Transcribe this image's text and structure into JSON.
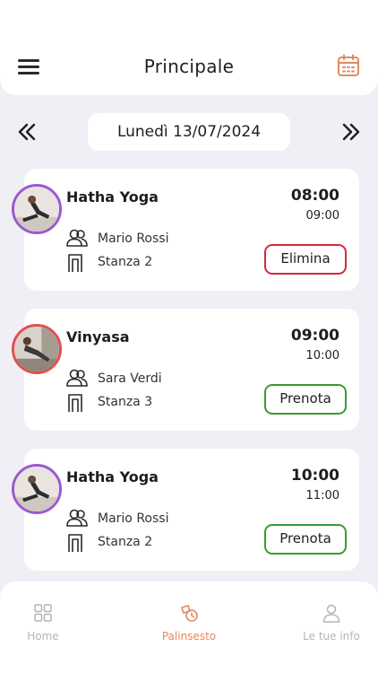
{
  "header": {
    "title": "Principale"
  },
  "date_nav": {
    "current_date": "Lunedì 13/07/2024"
  },
  "colors": {
    "accent": "#e28a5f",
    "delete": "#d42a3a",
    "book": "#3a9b2f",
    "purple_ring": "#9b59d0",
    "red_ring": "#e05050"
  },
  "classes": [
    {
      "name": "Hatha Yoga",
      "start": "08:00",
      "end": "09:00",
      "instructor": "Mario Rossi",
      "room": "Stanza 2",
      "action": "Elimina",
      "action_type": "delete",
      "ring": "purple"
    },
    {
      "name": "Vinyasa",
      "start": "09:00",
      "end": "10:00",
      "instructor": "Sara Verdi",
      "room": "Stanza 3",
      "action": "Prenota",
      "action_type": "book",
      "ring": "red"
    },
    {
      "name": "Hatha Yoga",
      "start": "10:00",
      "end": "11:00",
      "instructor": "Mario Rossi",
      "room": "Stanza 2",
      "action": "Prenota",
      "action_type": "book",
      "ring": "purple"
    }
  ],
  "bottom_nav": {
    "items": [
      {
        "label": "Home",
        "icon": "grid-icon",
        "active": false
      },
      {
        "label": "Palinsesto",
        "icon": "schedule-icon",
        "active": true
      },
      {
        "label": "Le tue info",
        "icon": "user-icon",
        "active": false
      }
    ]
  }
}
